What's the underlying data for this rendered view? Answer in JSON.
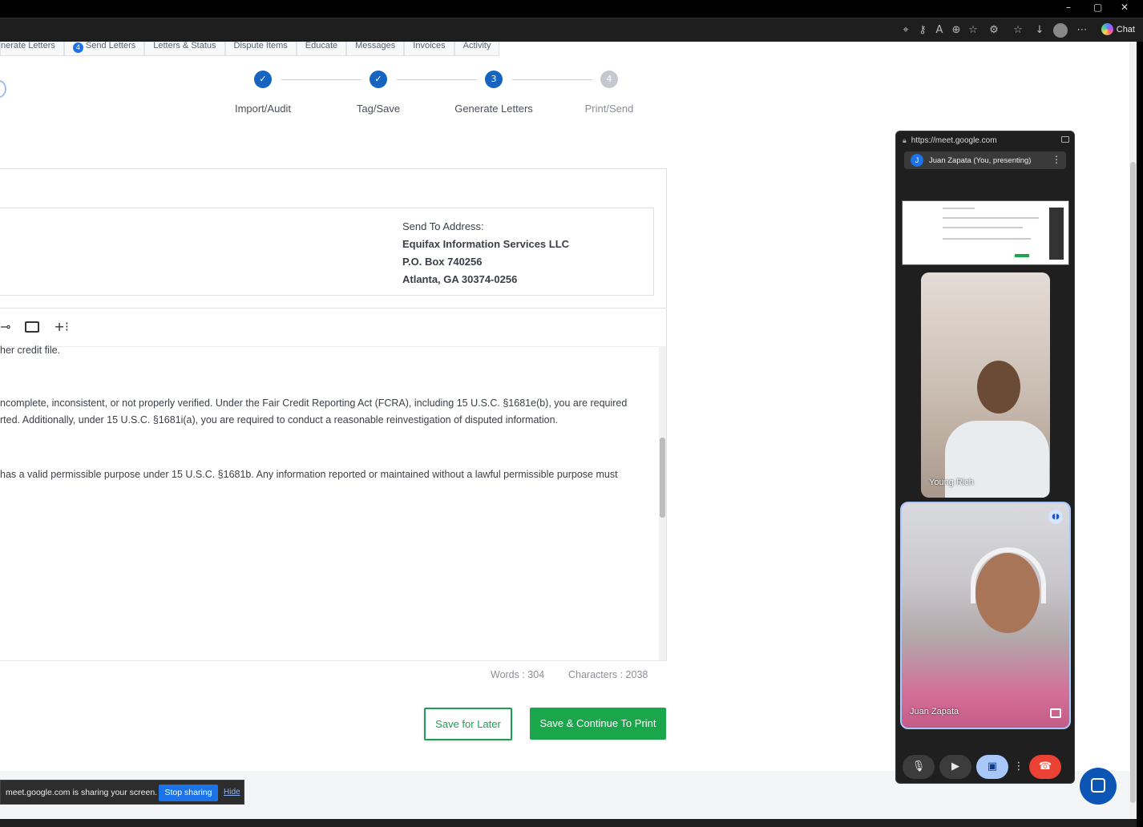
{
  "browser": {
    "chat_label": "Chat",
    "window_controls": [
      "–",
      "▢",
      "✕"
    ],
    "toolbar_icons": [
      "location-icon",
      "key-icon",
      "translate-icon",
      "zoom-icon",
      "star-icon",
      "extensions-icon",
      "favorites-icon",
      "download-icon",
      "profile-icon",
      "more-icon"
    ]
  },
  "tabs": [
    {
      "label": "nerate Letters"
    },
    {
      "label": "Send Letters",
      "badge": "4"
    },
    {
      "label": "Letters & Status"
    },
    {
      "label": "Dispute Items"
    },
    {
      "label": "Educate"
    },
    {
      "label": "Messages"
    },
    {
      "label": "Invoices"
    },
    {
      "label": "Activity"
    }
  ],
  "stepper": {
    "steps": [
      {
        "label": "Import/Audit",
        "state": "done",
        "marker": "✓"
      },
      {
        "label": "Tag/Save",
        "state": "done",
        "marker": "✓"
      },
      {
        "label": "Generate Letters",
        "state": "active",
        "marker": "3"
      },
      {
        "label": "Print/Send",
        "state": "todo",
        "marker": "4"
      }
    ]
  },
  "address": {
    "label": "Send To Address:",
    "name": "Equifax Information Services LLC",
    "line1": "P.O. Box 740256",
    "line2": "Atlanta, GA 30374-0256"
  },
  "editor": {
    "tools": [
      "link-icon",
      "image-icon",
      "insert-icon"
    ],
    "lines": [
      "her credit file.",
      "ncomplete, inconsistent, or not properly verified. Under the Fair Credit Reporting Act (FCRA), including 15 U.S.C. §1681e(b), you are required",
      "rted. Additionally, under 15 U.S.C. §1681i(a), you are required to conduct a reasonable reinvestigation of disputed information.",
      "has a valid permissible purpose under 15 U.S.C. §1681b. Any information reported or maintained without a lawful permissible purpose must"
    ],
    "words": "Words : 304",
    "characters": "Characters : 2038"
  },
  "actions": {
    "save_later": "Save for Later",
    "save_continue": "Save & Continue To Print"
  },
  "share_bar": {
    "text": "meet.google.com is sharing your screen.",
    "stop": "Stop sharing",
    "hide": "Hide"
  },
  "meet": {
    "url": "https://meet.google.com",
    "presenting_initial": "J",
    "presenting_label": "Juan Zapata (You, presenting)",
    "participant1": "Young Rich",
    "participant2": "Juan Zapata",
    "controls": [
      "mic-icon",
      "camera-icon",
      "present-icon",
      "more-icon",
      "end-call-icon"
    ]
  },
  "colors": {
    "accent_blue": "#1565c0",
    "green": "#1aa64a",
    "end_call": "#ea4335"
  }
}
